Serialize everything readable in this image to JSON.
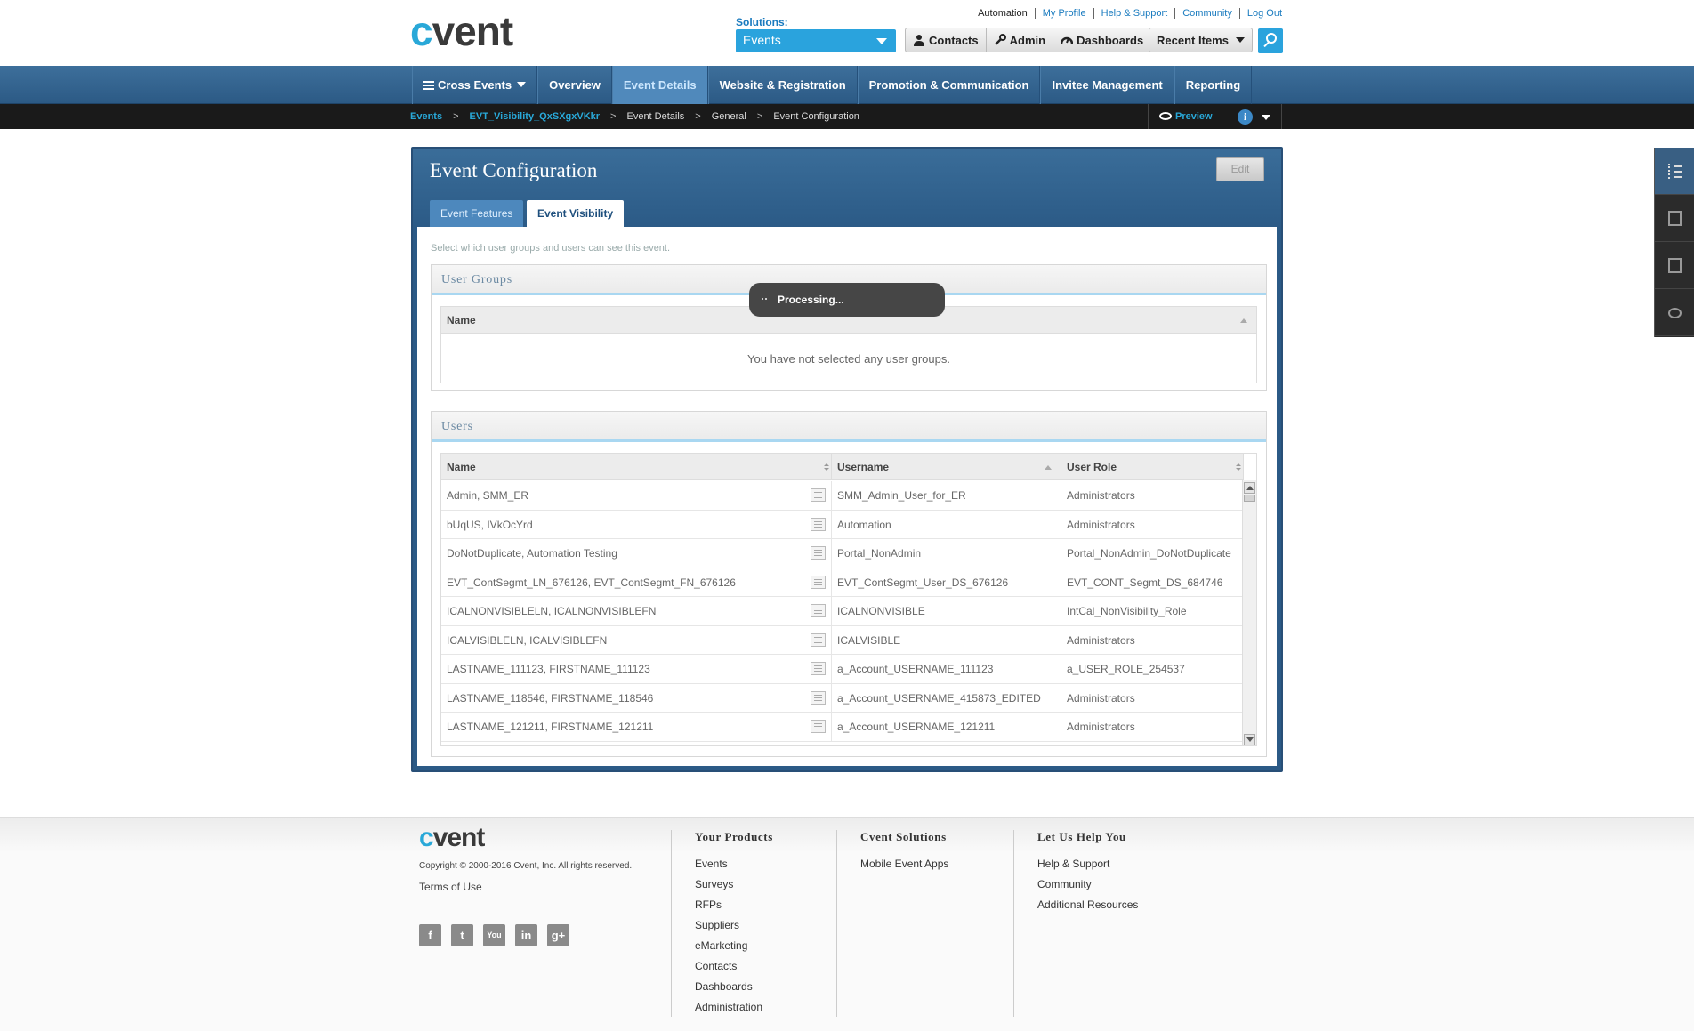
{
  "brand": {
    "logo_text_c": "c",
    "logo_text_rest": "vent"
  },
  "header": {
    "util_links": [
      "Automation",
      "My Profile",
      "Help & Support",
      "Community",
      "Log Out"
    ],
    "solutions_label": "Solutions:",
    "solutions_value": "Events",
    "buttons": {
      "contacts": "Contacts",
      "admin": "Admin",
      "dashboards": "Dashboards",
      "recent": "Recent Items"
    }
  },
  "nav": {
    "items": [
      "Cross Events",
      "Overview",
      "Event Details",
      "Website & Registration",
      "Promotion & Communication",
      "Invitee Management",
      "Reporting"
    ],
    "active": "Event Details"
  },
  "breadcrumb": {
    "items": [
      "Events",
      "EVT_Visibility_QxSXgxVKkr",
      "Event Details",
      "General",
      "Event Configuration"
    ],
    "separator": ">",
    "preview": "Preview",
    "info": "i"
  },
  "panel": {
    "title": "Event Configuration",
    "edit": "Edit",
    "tabs": [
      "Event Features",
      "Event Visibility"
    ],
    "active_tab": "Event Visibility",
    "helper": "Select which user groups and users can see this event.",
    "groups": {
      "heading": "User Groups",
      "col_name": "Name",
      "empty": "You have not selected any user groups."
    },
    "users": {
      "heading": "Users",
      "columns": [
        "Name",
        "Username",
        "User Role"
      ],
      "rows": [
        [
          "Admin, SMM_ER",
          "SMM_Admin_User_for_ER",
          "Administrators"
        ],
        [
          "bUqUS, IVkOcYrd",
          "Automation",
          "Administrators"
        ],
        [
          "DoNotDuplicate, Automation Testing",
          "Portal_NonAdmin",
          "Portal_NonAdmin_DoNotDuplicate"
        ],
        [
          "EVT_ContSegmt_LN_676126, EVT_ContSegmt_FN_676126",
          "EVT_ContSegmt_User_DS_676126",
          "EVT_CONT_Segmt_DS_684746"
        ],
        [
          "ICALNONVISIBLELN, ICALNONVISIBLEFN",
          "ICALNONVISIBLE",
          "IntCal_NonVisibility_Role"
        ],
        [
          "ICALVISIBLELN, ICALVISIBLEFN",
          "ICALVISIBLE",
          "Administrators"
        ],
        [
          "LASTNAME_111123, FIRSTNAME_111123",
          "a_Account_USERNAME_111123",
          "a_USER_ROLE_254537"
        ],
        [
          "LASTNAME_118546, FIRSTNAME_118546",
          "a_Account_USERNAME_415873_EDITED",
          "Administrators"
        ],
        [
          "LASTNAME_121211, FIRSTNAME_121211",
          "a_Account_USERNAME_121211",
          "Administrators"
        ]
      ]
    },
    "processing": "Processing..."
  },
  "footer": {
    "copyright": "Copyright © 2000-2016 Cvent, Inc. All rights reserved.",
    "terms": "Terms of Use",
    "socials": [
      "f",
      "t",
      "You",
      "in",
      "g+"
    ],
    "col1": {
      "heading": "Your Products",
      "links": [
        "Events",
        "Surveys",
        "RFPs",
        "Suppliers",
        "eMarketing",
        "Contacts",
        "Dashboards",
        "Administration"
      ]
    },
    "col2": {
      "heading": "Cvent Solutions",
      "links": [
        "Mobile Event Apps"
      ]
    },
    "col3": {
      "heading": "Let Us Help You",
      "links": [
        "Help & Support",
        "Community",
        "Additional Resources"
      ]
    }
  },
  "colors": {
    "accent": "#29a8d8",
    "nav": "#2c5a85",
    "active_nav": "#5089bb"
  }
}
